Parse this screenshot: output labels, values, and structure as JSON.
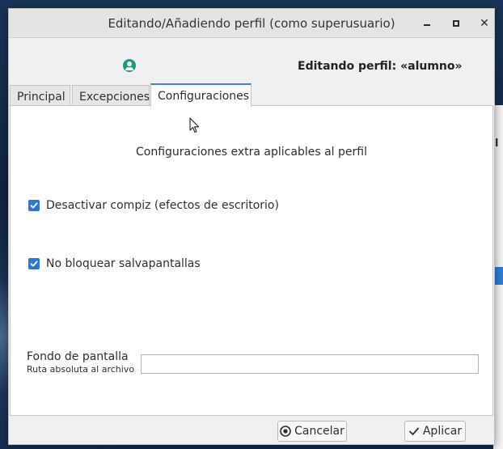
{
  "window": {
    "title": "Editando/Añadiendo perfil (como superusuario)",
    "close_glyph": "✕"
  },
  "header": {
    "icon": "user-circle-icon",
    "editing_label": "Editando perfil: «alumno»"
  },
  "tabs": [
    {
      "label": "Principal",
      "active": false
    },
    {
      "label": "Excepciones",
      "active": false
    },
    {
      "label": "Configuraciones",
      "active": true
    }
  ],
  "panel": {
    "heading": "Configuraciones extra aplicables al perfil",
    "options": [
      {
        "label": "Desactivar compiz (efectos de escritorio)",
        "checked": true
      },
      {
        "label": "No bloquear salvapantallas",
        "checked": true
      }
    ],
    "wallpaper": {
      "label": "Fondo de pantalla",
      "sublabel": "Ruta absoluta al archivo",
      "value": ""
    }
  },
  "footer": {
    "cancel_label": "Cancelar",
    "apply_label": "Aplicar"
  },
  "colors": {
    "accent": "#3b84d6",
    "checkbox": "#2f78d1",
    "user_icon": "#1e9a83"
  }
}
